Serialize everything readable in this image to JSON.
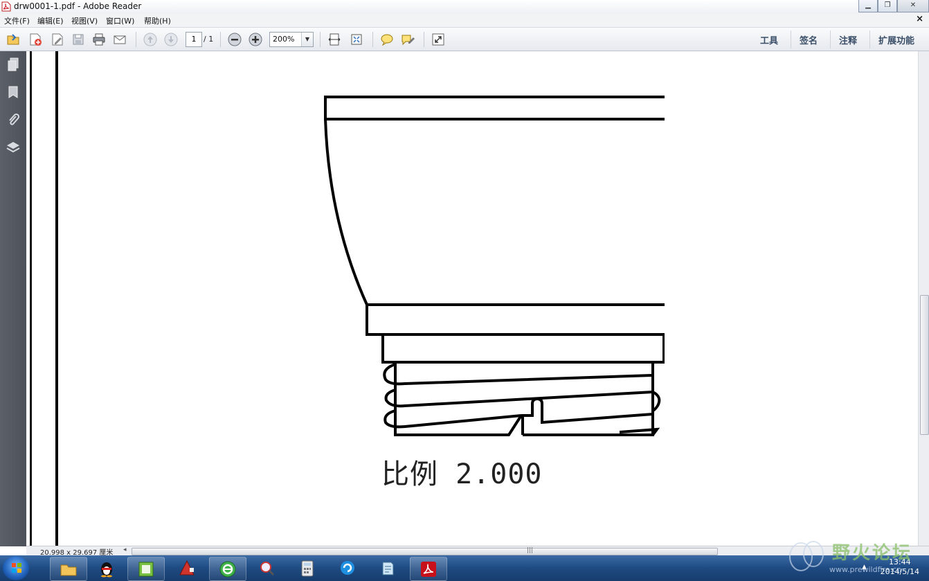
{
  "window": {
    "title": "drw0001-1.pdf - Adobe Reader",
    "minimize_glyph": "▁",
    "restore_glyph": "❐",
    "close_glyph": "✕"
  },
  "menu": {
    "items": [
      "文件(F)",
      "编辑(E)",
      "视图(V)",
      "窗口(W)",
      "帮助(H)"
    ],
    "doc_close": "×"
  },
  "toolbar": {
    "page_current": "1",
    "page_total": "/ 1",
    "zoom": "200%",
    "zoom_dropdown": "▼",
    "right_menu": [
      "工具",
      "签名",
      "注释",
      "扩展功能"
    ]
  },
  "document": {
    "scale_label": "比例  2.000"
  },
  "statusbar": {
    "page_size": "20.998 x 29.697 厘米",
    "left_arrow": "◂",
    "grip": "|||"
  },
  "taskbar": {
    "time": "13:44",
    "date": "2014/5/14",
    "tray_up": "▲",
    "watermark_text": "野火论坛",
    "watermark_url": "www.prewildfire.cn"
  },
  "colors": {
    "taskbar": "#1e4a82",
    "navpane": "#5c6068",
    "acrobat_red": "#c8101b"
  }
}
